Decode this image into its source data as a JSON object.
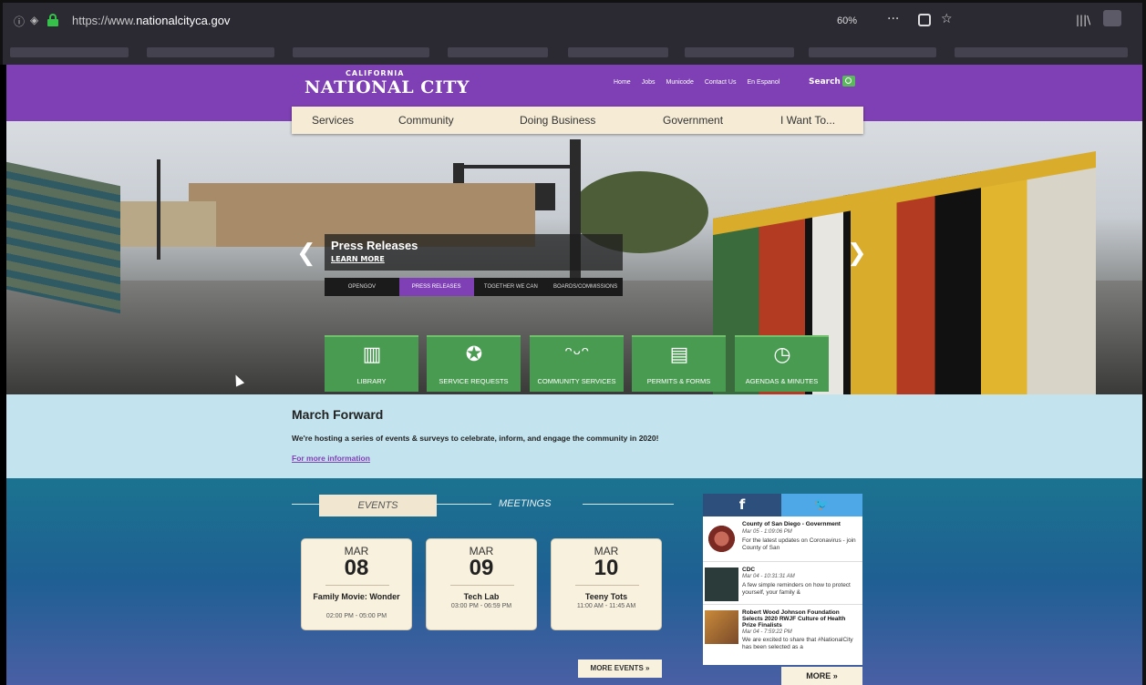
{
  "browser": {
    "url_prefix": "https://www.",
    "url_domain": "nationalcityca.gov",
    "zoom": "60%",
    "more_btn": "···",
    "library_btn": "|||\\"
  },
  "site": {
    "logo_small": "CALIFORNIA",
    "logo_big": "NATIONAL CITY",
    "top_links": [
      "Home",
      "Jobs",
      "Municode",
      "Contact Us",
      "En Espanol"
    ],
    "search_label": "Search",
    "nav": [
      "Services",
      "Community",
      "Doing Business",
      "Government",
      "I Want To..."
    ]
  },
  "hero": {
    "slide_title": "Press Releases",
    "slide_link": "LEARN MORE",
    "slide_tabs": [
      "OPENGOV",
      "PRESS RELEASES",
      "TOGETHER WE CAN",
      "BOARDS/COMMISSIONS"
    ],
    "active_slide_tab": "PRESS RELEASES",
    "quicklinks": [
      "LIBRARY",
      "SERVICE REQUESTS",
      "COMMUNITY SERVICES",
      "PERMITS & FORMS",
      "AGENDAS & MINUTES"
    ]
  },
  "announcement": {
    "title": "March Forward",
    "text": "We're hosting a series of events & surveys to celebrate, inform, and engage the community in 2020!",
    "link": "For more information"
  },
  "events": {
    "tab_events": "EVENTS",
    "tab_meetings": "MEETINGS",
    "cards": [
      {
        "month": "MAR",
        "day": "08",
        "name": "Family Movie: Wonder",
        "time": "02:00 PM - 05:00 PM"
      },
      {
        "month": "MAR",
        "day": "09",
        "name": "Tech Lab",
        "time": "03:00 PM - 06:59 PM"
      },
      {
        "month": "MAR",
        "day": "10",
        "name": "Teeny Tots",
        "time": "11:00 AM - 11:45 AM"
      }
    ],
    "more_events": "MORE EVENTS  »"
  },
  "social": {
    "fb_glyph": "f",
    "tw_glyph": "🐦",
    "feed": [
      {
        "title": "County of San Diego - Government",
        "date": "Mar 05 - 1:09:06 PM",
        "text": "For the latest updates on Coronavirus - join County of San"
      },
      {
        "title": "CDC",
        "date": "Mar 04 - 10:31:31 AM",
        "text": "A few simple reminders on how to protect yourself, your family &"
      },
      {
        "title": "Robert Wood Johnson Foundation Selects 2020 RWJF Culture of Health Prize Finalists",
        "date": "Mar 04 - 7:59:22 PM",
        "text": "We are excited to share that #NationalCity has been selected as a"
      }
    ],
    "more": "MORE  »"
  },
  "colors": {
    "brand_purple": "#7f3fb5",
    "quicklink_green": "#4a9b52",
    "facebook_blue": "#2c4f7c",
    "twitter_blue": "#4ea7e6"
  }
}
